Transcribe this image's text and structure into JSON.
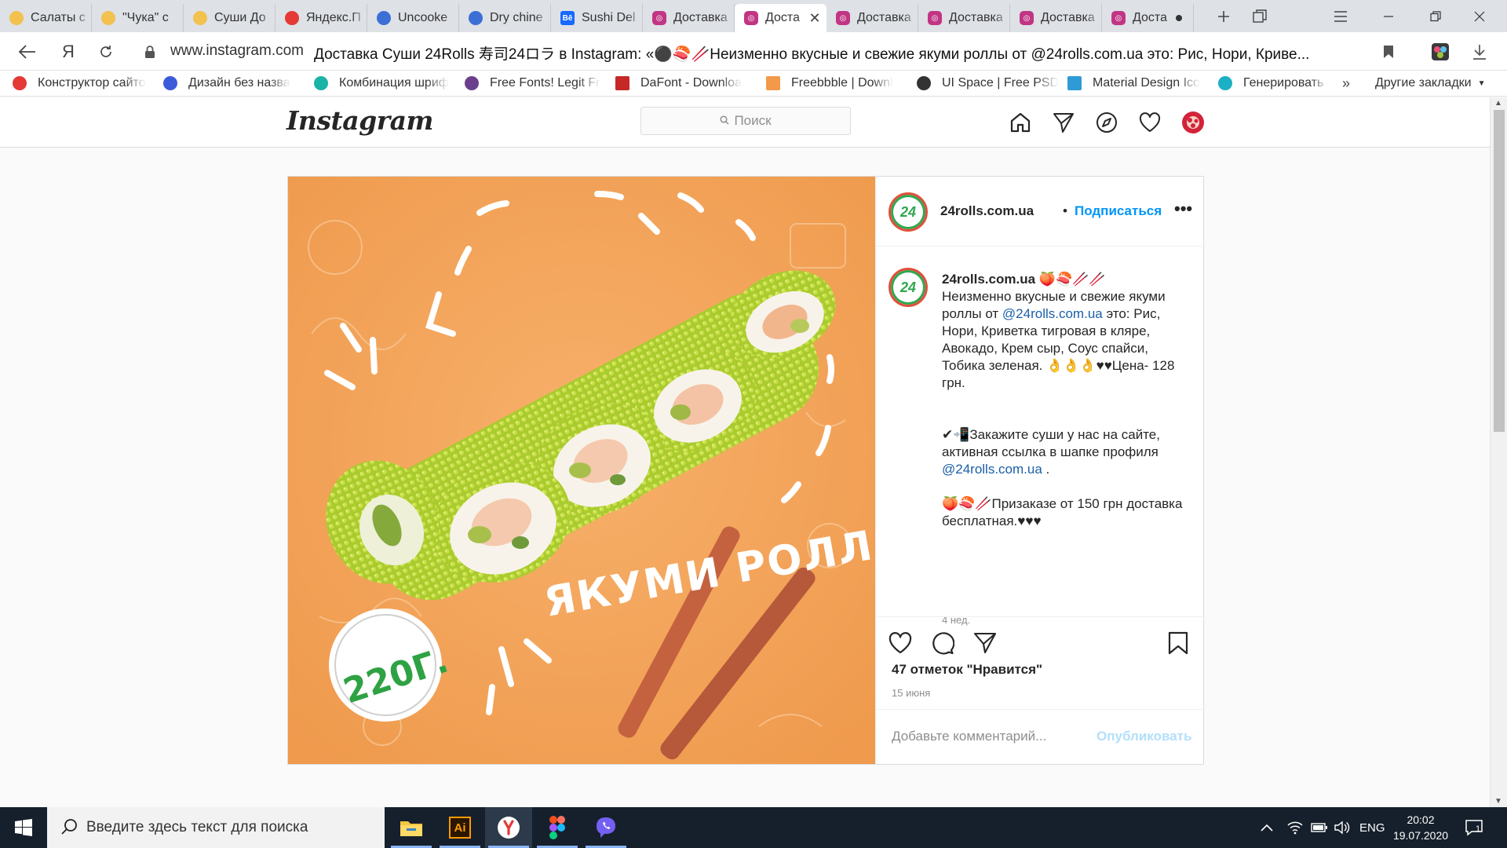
{
  "browser": {
    "tabs": [
      {
        "label": "Салаты с",
        "icon": "cactus-icon",
        "active": false
      },
      {
        "label": "\"Чука\" с",
        "icon": "cactus-icon",
        "active": false
      },
      {
        "label": "Суши До",
        "icon": "cactus-icon",
        "active": false
      },
      {
        "label": "Яндекс.П",
        "icon": "yandex-icon",
        "active": false
      },
      {
        "label": "Uncooke",
        "icon": "uncooked-icon",
        "active": false
      },
      {
        "label": "Dry chine",
        "icon": "uncooked-icon",
        "active": false
      },
      {
        "label": "Sushi Del",
        "icon": "behance-icon",
        "active": false
      },
      {
        "label": "Доставка",
        "icon": "instagram-icon",
        "active": false
      },
      {
        "label": "Доста",
        "icon": "instagram-icon",
        "active": true
      },
      {
        "label": "Доставка",
        "icon": "instagram-icon",
        "active": false
      },
      {
        "label": "Доставка",
        "icon": "instagram-icon",
        "active": false
      },
      {
        "label": "Доставка",
        "icon": "instagram-icon",
        "active": false
      },
      {
        "label": "Доста",
        "icon": "instagram-icon",
        "active": false
      }
    ],
    "address": {
      "domain": "www.instagram.com",
      "title": "Доставка Суши 24Rolls 寿司24ロラ в Instagram: «⚫️🍣🥢Неизменно вкусные и свежие якуми роллы от @24rolls.com.ua это: Рис, Нори, Криве..."
    },
    "bookmarks": [
      {
        "label": "Конструктор сайто",
        "color": "#e53935"
      },
      {
        "label": "Дизайн без назва",
        "color": "#3b5bdb"
      },
      {
        "label": "Комбинация шриф",
        "color": "#1bb3a5"
      },
      {
        "label": "Free Fonts! Legit Fr",
        "color": "#6b3f8c"
      },
      {
        "label": "DaFont - Downloa",
        "color": "#c62828"
      },
      {
        "label": "Freebbble | Downl",
        "color": "#f2994a"
      },
      {
        "label": "UI Space | Free PSD",
        "color": "#333333"
      },
      {
        "label": "Material Design Ico",
        "color": "#2e9bd6"
      },
      {
        "label": "Генерировать - Со",
        "color": "#1cb0c5"
      }
    ],
    "bookmarks_more": "»",
    "other_bookmarks": "Другие закладки"
  },
  "instagram": {
    "logo": "Instagram",
    "search_placeholder": "Поиск",
    "post": {
      "username": "24rolls.com.ua",
      "dot": "•",
      "follow": "Подписаться",
      "more": "•••",
      "avatar_text": "24",
      "image_texts": {
        "title": "ЯКУМИ РОЛЛ",
        "weight": "220Г."
      },
      "caption": {
        "username": "24rolls.com.ua",
        "emoji_after_name": "🍑🍣🥢🥢",
        "line1_pre": "Неизменно вкусные и свежие якуми роллы от ",
        "mention1": "@24rolls.com.ua",
        "line1_post": " это: Рис, Нори, Криветка тигровая в кляре, Авокадо, Крем сыр, Соус спайси, Тобика зеленая. 👌👌👌♥♥Цена- 128 грн.",
        "line2_pre": "✔📲Закажите суши у нас на сайте, активная ссылка в шапке профиля ",
        "mention2": "@24rolls.com.ua",
        "line2_post": " .",
        "line3": "🍑🍣🥢Призаказе от 150 грн доставка бесплатная.♥♥♥"
      },
      "age": "4 нед.",
      "likes": "47 отметок \"Нравится\"",
      "date": "15 июня",
      "comment_placeholder": "Добавьте комментарий...",
      "publish": "Опубликовать"
    }
  },
  "taskbar": {
    "search_placeholder": "Введите здесь текст для поиска",
    "apps": [
      "file-explorer-icon",
      "illustrator-icon",
      "yandex-browser-icon",
      "figma-icon",
      "viber-icon"
    ],
    "illustrator_label": "Ai",
    "language": "ENG",
    "time": "20:02",
    "date": "19.07.2020",
    "notifications": "1"
  },
  "colors": {
    "instagram_blue": "#0095f6",
    "post_background": "#f3a15a",
    "roll_green": "#b6d43a",
    "taskbar": "#16202c"
  }
}
